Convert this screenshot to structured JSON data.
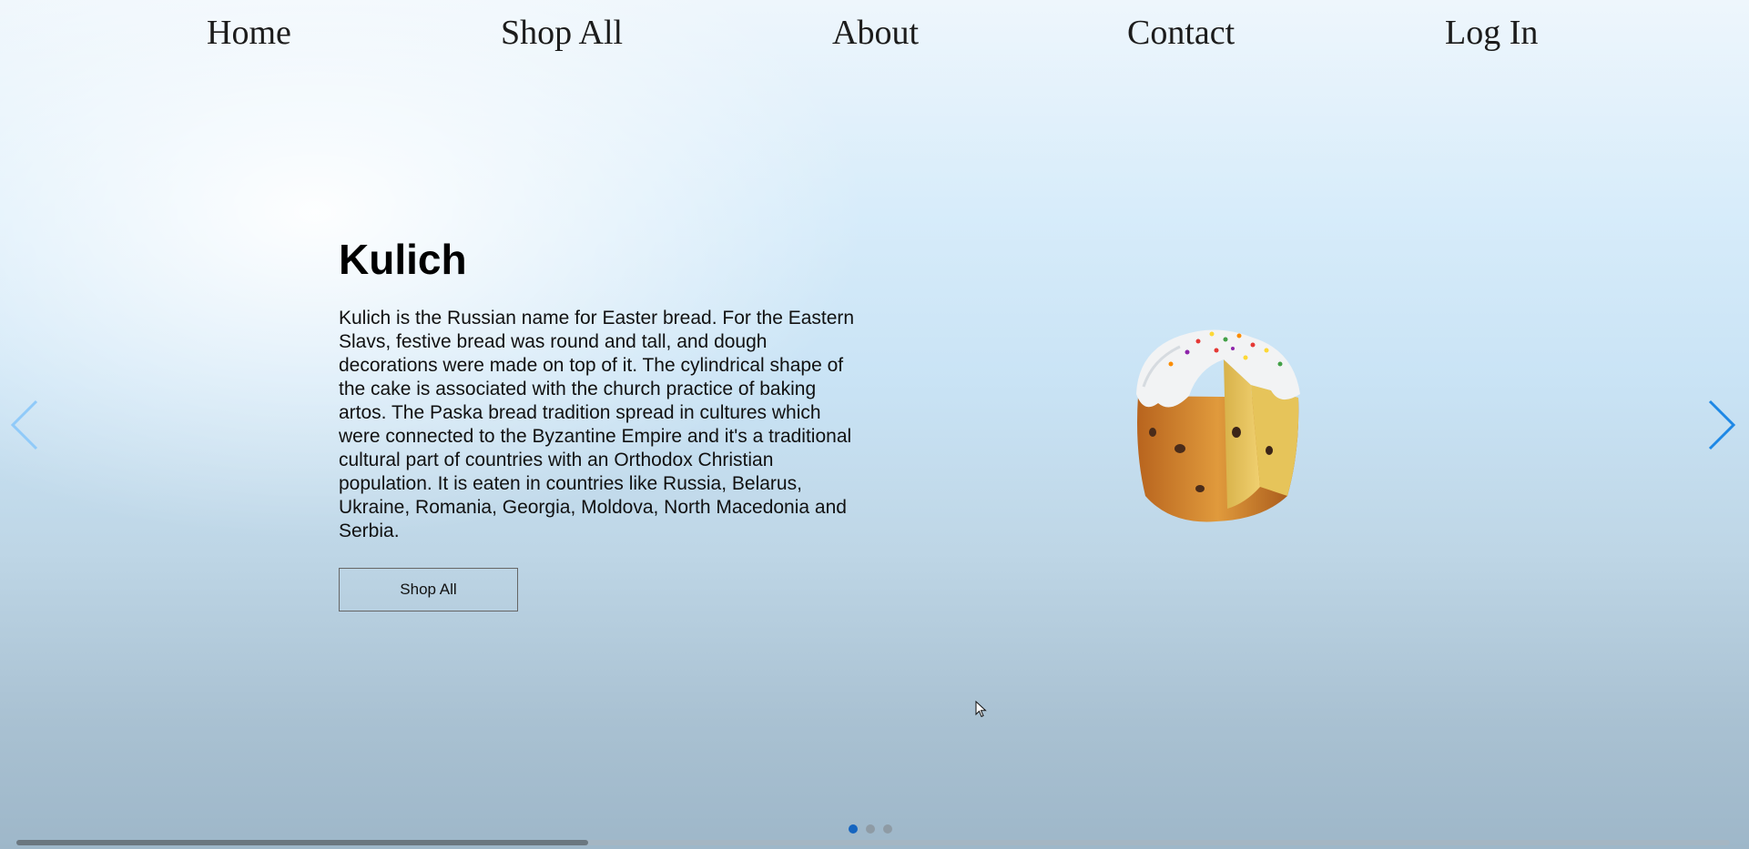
{
  "nav": {
    "items": [
      {
        "label": "Home"
      },
      {
        "label": "Shop All"
      },
      {
        "label": "About"
      },
      {
        "label": "Contact"
      },
      {
        "label": "Log In"
      }
    ]
  },
  "slide": {
    "title": "Kulich",
    "description": "Kulich is the Russian name for Easter bread. For the Eastern Slavs, festive bread was round and tall, and dough decorations were made on top of it. The cylindrical shape of the cake is associated with the church practice of baking artos. The Paska bread tradition spread in cultures which were connected to the Byzantine Empire and it's a traditional cultural part of countries with an Orthodox Christian population. It is eaten in countries like Russia, Belarus, Ukraine, Romania, Georgia, Moldova, North Macedonia and Serbia.",
    "button_label": "Shop All",
    "image_icon": "kulich-cake-image"
  },
  "carousel": {
    "prev_icon": "chevron-left-icon",
    "next_icon": "chevron-right-icon",
    "slide_count": 3,
    "active_index": 0,
    "active_dot_color": "#1565c0",
    "arrow_color": "#1e88e5"
  }
}
